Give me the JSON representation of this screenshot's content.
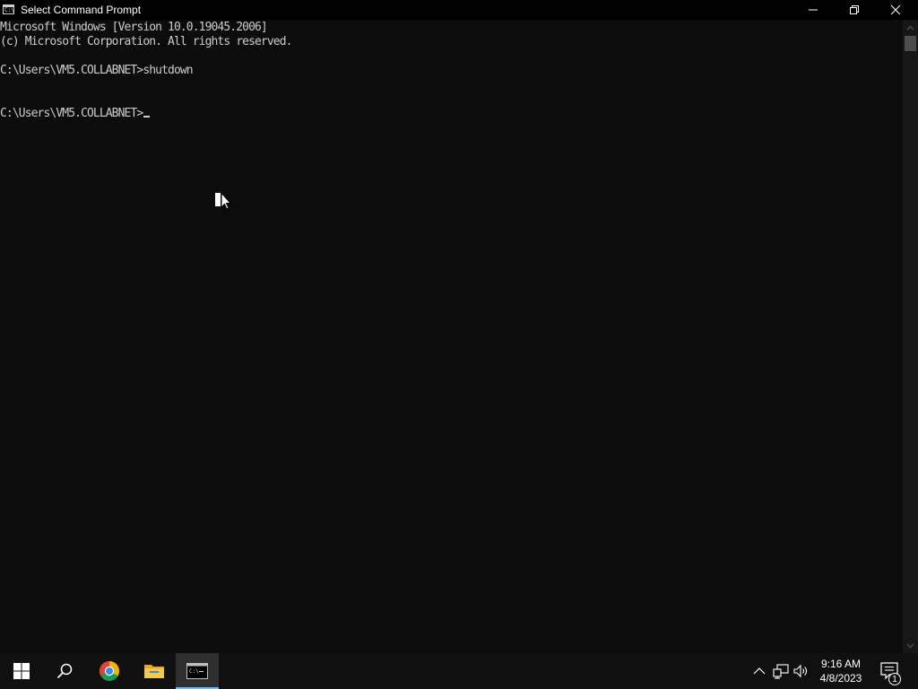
{
  "window": {
    "title": "Select Command Prompt",
    "app_icon_text": "C:\\"
  },
  "console": {
    "lines": [
      "Microsoft Windows [Version 10.0.19045.2006]",
      "(c) Microsoft Corporation. All rights reserved.",
      "",
      "C:\\Users\\VM5.COLLABNET>shutdown",
      "",
      "",
      "C:\\Users\\VM5.COLLABNET>"
    ]
  },
  "taskbar": {
    "items": [
      {
        "name": "start-button",
        "icon": "windows-logo-icon"
      },
      {
        "name": "search-button",
        "icon": "search-icon"
      },
      {
        "name": "chrome",
        "icon": "chrome-icon"
      },
      {
        "name": "file-explorer",
        "icon": "folder-icon"
      },
      {
        "name": "command-prompt",
        "icon": "cmd-icon",
        "active": true
      }
    ],
    "tray": {
      "icons": [
        "chevron-up-icon",
        "network-icon",
        "volume-icon"
      ]
    },
    "clock": {
      "time": "9:16 AM",
      "date": "4/8/2023"
    },
    "notifications": {
      "count": "1"
    }
  },
  "colors": {
    "console_bg": "#0c0c0c",
    "console_text": "#cccccc",
    "titlebar_bg": "#000000",
    "taskbar_bg": "#101010",
    "taskbar_accent": "#76b9ed"
  }
}
